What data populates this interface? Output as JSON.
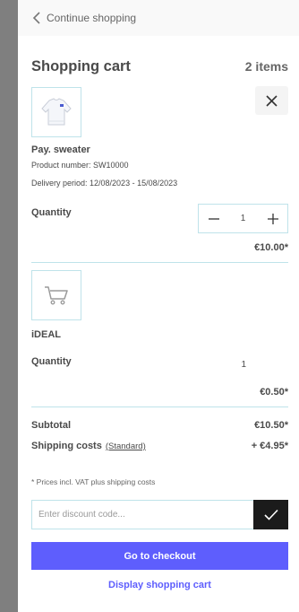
{
  "topbar": {
    "continue_label": "Continue shopping"
  },
  "cart": {
    "title": "Shopping cart",
    "count": "2 items"
  },
  "items": [
    {
      "name": "Pay. sweater",
      "product_number": "Product number: SW10000",
      "delivery": "Delivery period: 12/08/2023 - 15/08/2023",
      "qty_label": "Quantity",
      "qty": "1",
      "price": "€10.00*",
      "image_icon": "sweater-icon"
    },
    {
      "name": "iDEAL",
      "qty_label": "Quantity",
      "qty": "1",
      "price": "€0.50*",
      "image_icon": "shopping-cart-icon"
    }
  ],
  "summary": {
    "subtotal_label": "Subtotal",
    "subtotal_value": "€10.50*",
    "shipping_label": "Shipping costs",
    "shipping_method": "(Standard)",
    "shipping_value": "+ €4.95*",
    "note": "* Prices incl. VAT plus shipping costs"
  },
  "discount": {
    "placeholder": "Enter discount code...",
    "value": ""
  },
  "actions": {
    "checkout": "Go to checkout",
    "display_cart": "Display shopping cart"
  },
  "colors": {
    "accent": "#5e5efd",
    "border": "#bfe3ea",
    "apply_button": "#1b1b1b"
  }
}
